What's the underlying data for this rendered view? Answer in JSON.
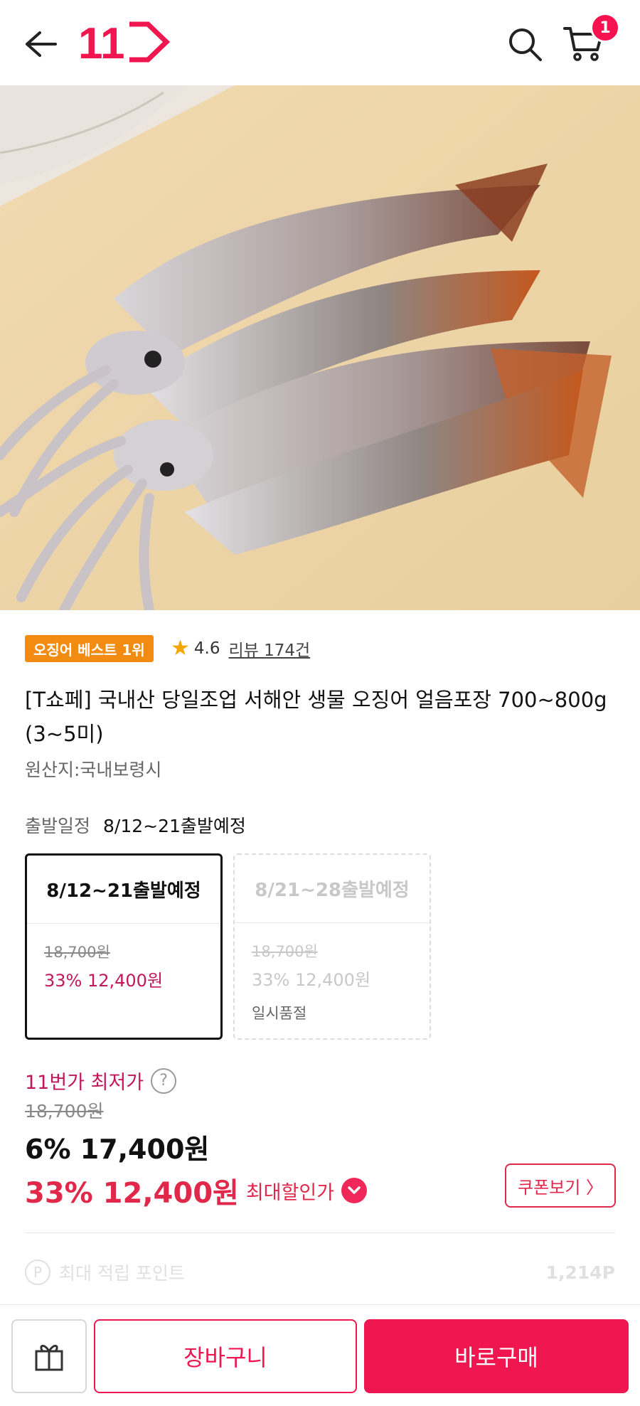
{
  "header": {
    "logo_text": "11",
    "cart_count": "1",
    "icons": {
      "back": "arrow-left-icon",
      "search": "search-icon",
      "cart": "cart-icon"
    }
  },
  "product": {
    "best_badge": "오징어 베스트 1위",
    "rating": "4.6",
    "review_label": "리뷰 174건",
    "title": "[T쇼페] 국내산 당일조업 서해안 생물 오징어 얼음포장 700~800g (3~5미)",
    "origin": "원산지:국내보령시"
  },
  "departure": {
    "label": "출발일정",
    "value": "8/12~21출발예정",
    "options": [
      {
        "title": "8/12~21출발예정",
        "original": "18,700원",
        "discount": "33% 12,400원",
        "status": ""
      },
      {
        "title": "8/21~28출발예정",
        "original": "18,700원",
        "discount": "33% 12,400원",
        "status": "일시품절"
      }
    ]
  },
  "pricing": {
    "lowest_label": "11번가 최저가",
    "original": "18,700원",
    "sale": "6% 17,400원",
    "max_amount": "33% 12,400원",
    "max_label": "최대할인가",
    "coupon_button": "쿠폰보기 〉"
  },
  "points": {
    "label": "최대 적립 포인트",
    "value": "1,214P"
  },
  "bottom_bar": {
    "cart_button": "장바구니",
    "buy_button": "바로구매"
  },
  "colors": {
    "brand": "#f0164f",
    "badge": "#f28b12",
    "discount": "#e0284a"
  }
}
